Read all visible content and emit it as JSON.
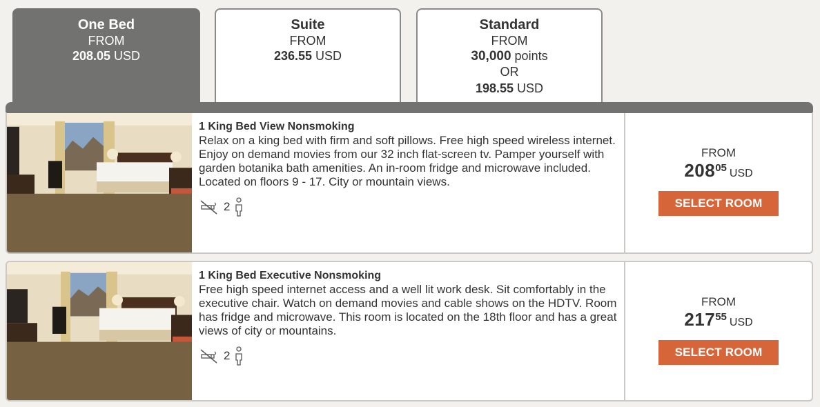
{
  "tabs": [
    {
      "name": "One Bed",
      "from_label": "FROM",
      "price": "208.05",
      "currency": "USD",
      "active": true
    },
    {
      "name": "Suite",
      "from_label": "FROM",
      "price": "236.55",
      "currency": "USD",
      "active": false
    },
    {
      "name": "Standard",
      "from_label": "FROM",
      "points": "30,000",
      "points_label": "points",
      "or_label": "OR",
      "price": "198.55",
      "currency": "USD",
      "active": false
    }
  ],
  "rooms": [
    {
      "title": "1 King Bed View Nonsmoking",
      "description": "Relax on a king bed with firm and soft pillows. Free high speed wireless internet. Enjoy on demand movies from our 32 inch flat-screen tv. Pamper yourself with garden botanika bath amenities. An in-room fridge and microwave included. Located on floors 9 - 17. City or mountain views.",
      "occupancy": "2",
      "from_label": "FROM",
      "price_whole": "208",
      "price_cents": "05",
      "currency": "USD",
      "button_label": "SELECT ROOM"
    },
    {
      "title": "1 King Bed Executive Nonsmoking",
      "description": "Free high speed internet access and a well lit work desk. Sit comfortably in the executive chair. Watch on demand movies and cable shows on the HDTV. Room has fridge and microwave. This room is located on the 18th floor and has a great views of city or mountains.",
      "occupancy": "2",
      "from_label": "FROM",
      "price_whole": "217",
      "price_cents": "55",
      "currency": "USD",
      "button_label": "SELECT ROOM"
    }
  ],
  "icons": {
    "no_smoking": "no-smoking-icon",
    "person": "person-icon"
  },
  "colors": {
    "active_tab": "#727270",
    "button": "#d6653a",
    "background": "#f2f1ed"
  }
}
